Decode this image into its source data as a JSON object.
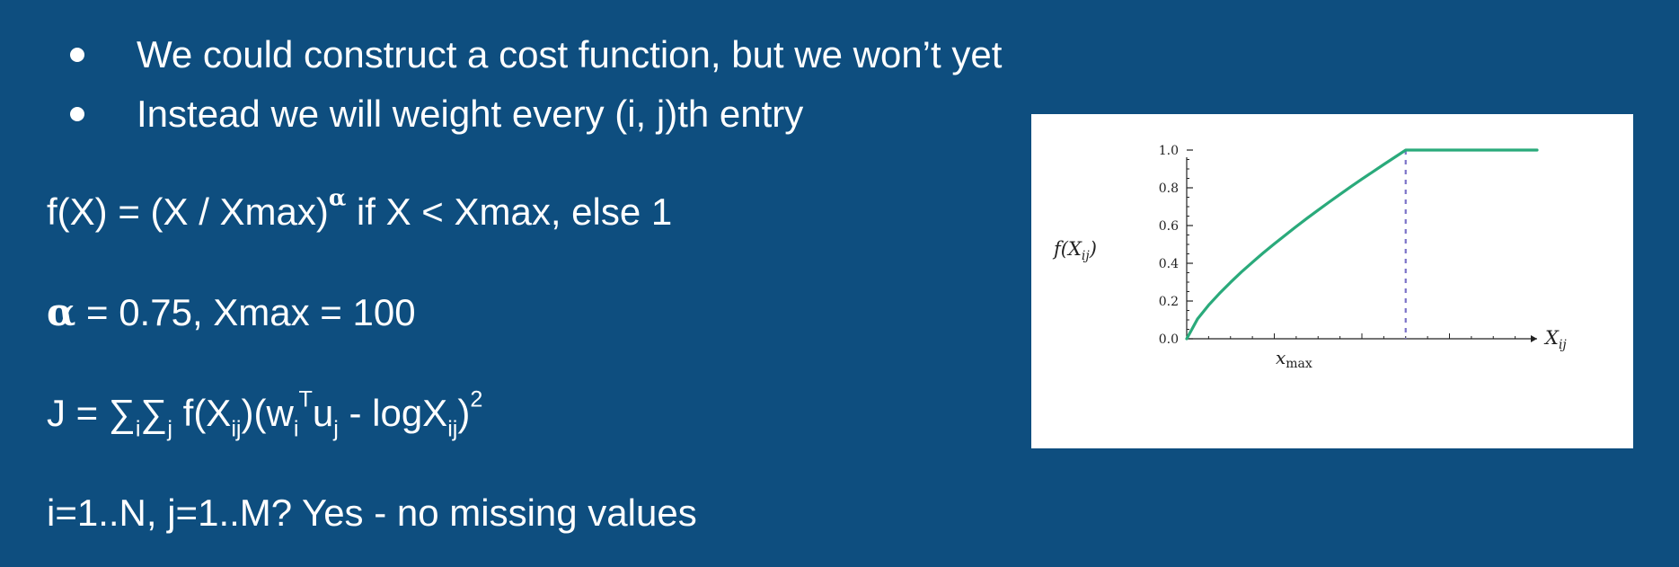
{
  "slide": {
    "bullets": [
      {
        "text": "We could construct a cost function, but we won’t yet"
      },
      {
        "text": "Instead we will weight every (i, j)th entry"
      }
    ],
    "formula_f": {
      "prefix": "f(X) = (X / Xmax)",
      "exponent": "α",
      "suffix": " if X < Xmax, else 1"
    },
    "params": {
      "alpha_symbol": "α",
      "text": " = 0.75, Xmax = 100"
    },
    "cost": {
      "lead": "J = ∑",
      "sub_i1": "i",
      "sigma2": "∑",
      "sub_j1": "j",
      "f_open": " f(X",
      "sub_ij1": "ij",
      "mid1": ")(w",
      "sub_i2": "i",
      "sup_T": "T",
      "u": "u",
      "sub_j2": "j",
      "mid2": " - logX",
      "sub_ij2": "ij",
      "close": ")",
      "sup_2": "2"
    },
    "note": "i=1..N, j=1..M? Yes - no missing values"
  },
  "chart_data": {
    "type": "line",
    "xlabel": "X_ij",
    "ylabel": "f(X_ij)",
    "xtick_labels": [
      "x_max"
    ],
    "xlim": [
      0,
      1.6
    ],
    "ylim": [
      0,
      1.0
    ],
    "ytick_labels": [
      "0.0",
      "0.2",
      "0.4",
      "0.6",
      "0.8",
      "1.0"
    ],
    "series": [
      {
        "color": "#2aaa7b",
        "x": [
          0,
          0.05,
          0.1,
          0.15,
          0.2,
          0.25,
          0.3,
          0.35,
          0.4,
          0.45,
          0.5,
          0.55,
          0.6,
          0.65,
          0.7,
          0.75,
          0.8,
          0.85,
          0.9,
          0.95,
          1.0,
          1.25,
          1.6
        ],
        "y": [
          0,
          0.106,
          0.178,
          0.241,
          0.299,
          0.354,
          0.405,
          0.455,
          0.503,
          0.549,
          0.595,
          0.639,
          0.682,
          0.724,
          0.765,
          0.806,
          0.846,
          0.885,
          0.924,
          0.962,
          1.0,
          1.0,
          1.0
        ]
      }
    ],
    "vlines": [
      {
        "x": 1.0,
        "style": "dashed",
        "color": "#7b72c8"
      }
    ],
    "grid": false
  }
}
